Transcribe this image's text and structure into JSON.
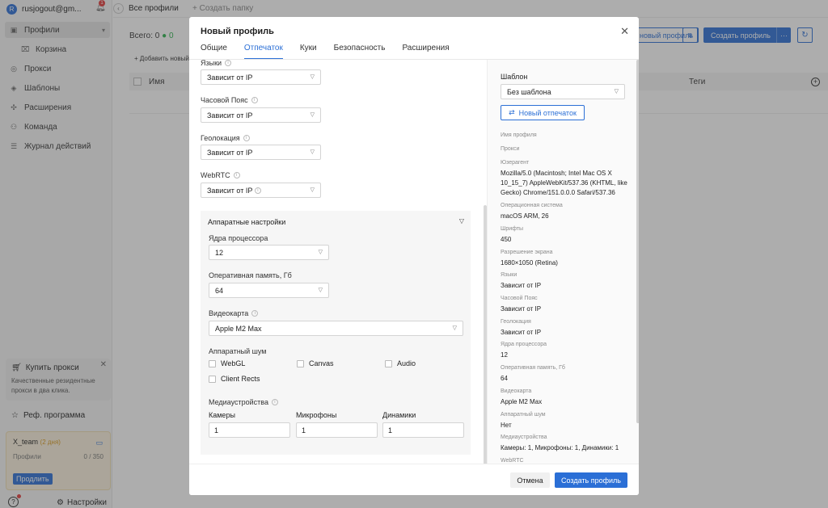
{
  "sidebar": {
    "account_initial": "R",
    "account_email": "rusjogout@gm...",
    "notif_count": "1",
    "items": [
      {
        "label": "Профили",
        "icon": "profile-icon"
      },
      {
        "label": "Корзина",
        "icon": "trash-icon"
      },
      {
        "label": "Прокси",
        "icon": "globe-icon"
      },
      {
        "label": "Шаблоны",
        "icon": "template-icon"
      },
      {
        "label": "Расширения",
        "icon": "puzzle-icon"
      },
      {
        "label": "Команда",
        "icon": "team-icon"
      },
      {
        "label": "Журнал действий",
        "icon": "log-icon"
      }
    ],
    "promo": {
      "title": "Купить прокси",
      "text": "Качественные резидентные прокси в два клика."
    },
    "referral": "Реф. программа",
    "team": {
      "name": "X_team",
      "days": "(2 дня)",
      "profiles_label": "Профили",
      "profiles_value": "0 / 350",
      "extend": "Продлить"
    },
    "settings": "Настройки"
  },
  "main": {
    "breadcrumb": "Все профили",
    "new_folder": "Создать папку",
    "count_label": "Всего:",
    "count_value": "0",
    "count_active": "0",
    "add_folder": "Добавить новый",
    "col_name": "Имя",
    "col_tags": "Теги",
    "btn_light": "новый профиль",
    "btn_create": "Создать профиль",
    "btn_more": "···"
  },
  "modal": {
    "title": "Новый профиль",
    "tabs": [
      "Общие",
      "Отпечаток",
      "Куки",
      "Безопасность",
      "Расширения"
    ],
    "fields": {
      "languages": {
        "label": "Языки",
        "value": "Зависит от IP"
      },
      "timezone": {
        "label": "Часовой Пояс",
        "value": "Зависит от IP"
      },
      "geolocation": {
        "label": "Геолокация",
        "value": "Зависит от IP"
      },
      "webrtc": {
        "label": "WebRTC",
        "value": "Зависит от IP"
      }
    },
    "hardware": {
      "title": "Аппаратные настройки",
      "cpu": {
        "label": "Ядра процессора",
        "value": "12"
      },
      "ram": {
        "label": "Оперативная память, Гб",
        "value": "64"
      },
      "gpu": {
        "label": "Видеокарта",
        "value": "Apple M2 Max"
      },
      "noise": {
        "label": "Аппаратный шум",
        "options": [
          "WebGL",
          "Canvas",
          "Audio",
          "Client Rects"
        ]
      },
      "media": {
        "label": "Медиаустройства",
        "cameras_label": "Камеры",
        "cameras": "1",
        "mics_label": "Микрофоны",
        "mics": "1",
        "speakers_label": "Динамики",
        "speakers": "1"
      }
    },
    "summary": {
      "template_title": "Шаблон",
      "template_value": "Без шаблона",
      "new_fp_btn": "Новый отпечаток",
      "rows": [
        {
          "k": "Имя профиля",
          "v": ""
        },
        {
          "k": "Прокси",
          "v": ""
        },
        {
          "k": "Юзерагент",
          "v": "Mozilla/5.0 (Macintosh; Intel Mac OS X 10_15_7) AppleWebKit/537.36 (KHTML, like Gecko) Chrome/151.0.0.0 Safari/537.36"
        },
        {
          "k": "Операционная система",
          "v": "macOS ARM, 26"
        },
        {
          "k": "Шрифты",
          "v": "450"
        },
        {
          "k": "Разрешение экрана",
          "v": "1680×1050 (Retina)"
        },
        {
          "k": "Языки",
          "v": "Зависит от IP"
        },
        {
          "k": "Часовой Пояс",
          "v": "Зависит от IP"
        },
        {
          "k": "Геолокация",
          "v": "Зависит от IP"
        },
        {
          "k": "Ядра процессора",
          "v": "12"
        },
        {
          "k": "Оперативная память, Гб",
          "v": "64"
        },
        {
          "k": "Видеокарта",
          "v": "Apple M2 Max"
        },
        {
          "k": "Аппаратный шум",
          "v": "Нет"
        },
        {
          "k": "Медиаустройства",
          "v": "Камеры: 1, Микрофоны: 1, Динамики: 1"
        },
        {
          "k": "WebRTC",
          "v": ""
        }
      ]
    },
    "cancel": "Отмена",
    "submit": "Создать профиль"
  }
}
